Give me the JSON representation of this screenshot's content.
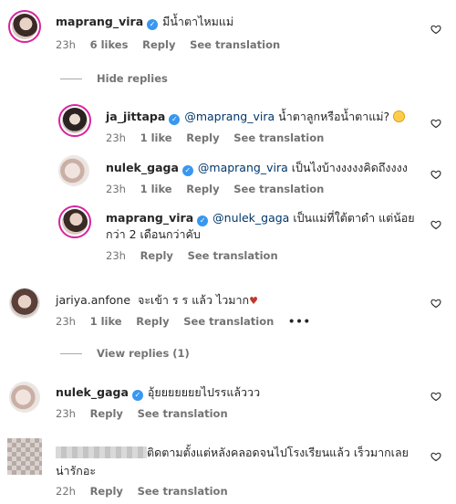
{
  "comments": [
    {
      "username": "maprang_vira",
      "verified": true,
      "text": "มีน้ำตาไหมแม่",
      "time": "23h",
      "likes": "6 likes",
      "reply": "Reply",
      "translate": "See translation"
    },
    {
      "username": "ja_jittapa",
      "verified": true,
      "mention": "@maprang_vira",
      "text": "น้ำตาลูกหรือน้ำตาแม่?",
      "time": "23h",
      "likes": "1 like",
      "reply": "Reply",
      "translate": "See translation"
    },
    {
      "username": "nulek_gaga",
      "verified": true,
      "mention": "@maprang_vira",
      "text": "เป็นไงบ้างงงงงคิดถึงงงง",
      "time": "23h",
      "likes": "1 like",
      "reply": "Reply",
      "translate": "See translation"
    },
    {
      "username": "maprang_vira",
      "verified": true,
      "mention": "@nulek_gaga",
      "text": "เป็นแม่ที่ใต้ตาดำ แต่น้อยกว่า 2 เดือนกว่าคับ",
      "time": "23h",
      "reply": "Reply",
      "translate": "See translation"
    },
    {
      "username": "jariya.anfone",
      "text": "จะเข้า ร ร แล้ว ไวมาก",
      "time": "23h",
      "likes": "1 like",
      "reply": "Reply",
      "translate": "See translation",
      "more": "•••"
    },
    {
      "username": "nulek_gaga",
      "verified": true,
      "text": "อุ้ยยยยยยยไปรรแล้ววว",
      "time": "23h",
      "reply": "Reply",
      "translate": "See translation"
    },
    {
      "text": "ติดตามตั้งแต่หลังคลอดจนไปโรงเรียนแล้ว เร็วมากเลย น่ารักอะ",
      "time": "22h",
      "reply": "Reply",
      "translate": "See translation"
    }
  ],
  "hide_replies": "Hide replies",
  "view_replies": "View replies (1)",
  "verified_glyph": "✓",
  "colors": {
    "story_ring": "#d6249f",
    "verified": "#3897f0",
    "mention": "#00376b",
    "muted": "#737373"
  },
  "icons": [
    "heart-icon",
    "verified-icon",
    "more-icon"
  ]
}
